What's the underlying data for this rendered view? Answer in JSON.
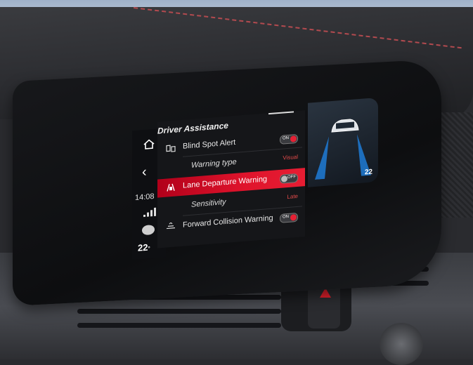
{
  "rail": {
    "time": "14:08",
    "temperature": "22",
    "temperature_unit": "°"
  },
  "panel": {
    "title": "Driver Assistance",
    "rows": [
      {
        "label": "Blind Spot Alert",
        "toggle": "ON"
      },
      {
        "label": "Warning type",
        "value": "Visual"
      },
      {
        "label": "Lane Departure Warning",
        "toggle": "OFF",
        "highlight": true
      },
      {
        "label": "Sensitivity",
        "value": "Late"
      },
      {
        "label": "Forward Collision Warning",
        "toggle": "ON"
      }
    ]
  },
  "side": {
    "temperature": "22"
  },
  "colors": {
    "accent": "#e0142c",
    "value_text": "#e24a4a"
  },
  "icons": {
    "home": "home-icon",
    "back": "chevron-left-icon",
    "signal": "signal-icon",
    "profile": "driver-profile-icon",
    "blind_spot": "blind-spot-icon",
    "lane": "lane-departure-icon",
    "collision": "forward-collision-icon"
  }
}
